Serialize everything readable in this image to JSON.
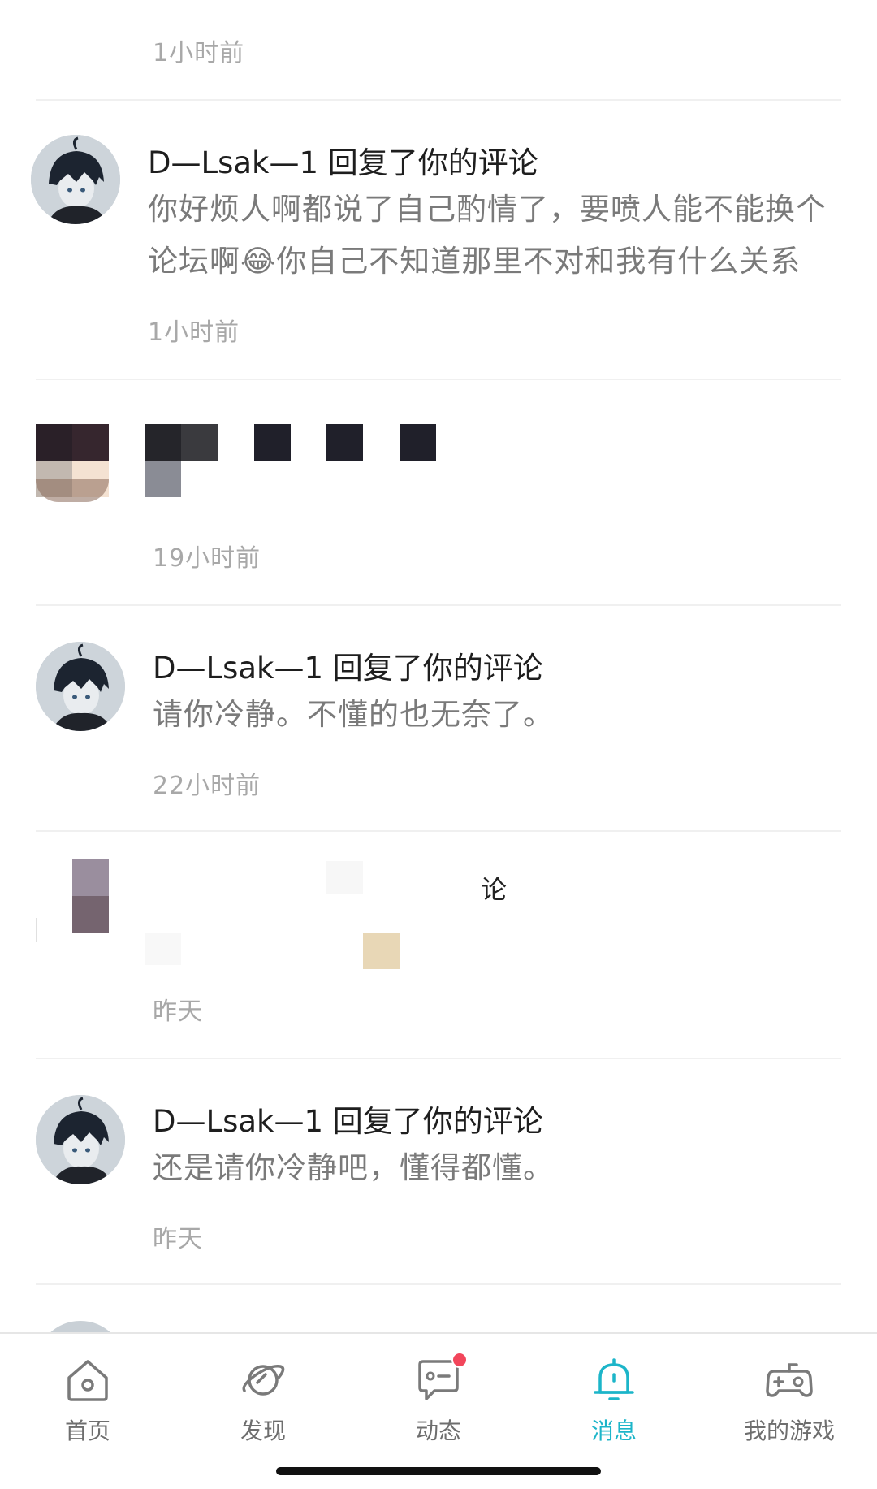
{
  "messages": [
    {
      "time": "1小时前"
    },
    {
      "user": "D—Lsak—1",
      "action": "回复了你的评论",
      "content": "你好烦人啊都说了自己酌情了，要喷人能不能换个论坛啊😂你自己不知道那里不对和我有什么关系",
      "time": "1小时前"
    },
    {
      "time": "19小时前"
    },
    {
      "user": "D—Lsak—1",
      "action": "回复了你的评论",
      "content": "请你冷静。不懂的也无奈了。",
      "time": "22小时前"
    },
    {
      "title_fragment": "论",
      "time": "昨天"
    },
    {
      "user": "D—Lsak—1",
      "action": "回复了你的评论",
      "content": "还是请你冷静吧，懂得都懂。",
      "time": "昨天"
    }
  ],
  "tabbar": {
    "active": "消息",
    "accent_color": "#1cb5c9",
    "badge_color": "#f2465b",
    "tabs": [
      {
        "label": "首页",
        "icon": "home-icon"
      },
      {
        "label": "发现",
        "icon": "planet-icon"
      },
      {
        "label": "动态",
        "icon": "chat-bubble-icon"
      },
      {
        "label": "消息",
        "icon": "bell-icon"
      },
      {
        "label": "我的游戏",
        "icon": "gamepad-icon"
      }
    ]
  }
}
